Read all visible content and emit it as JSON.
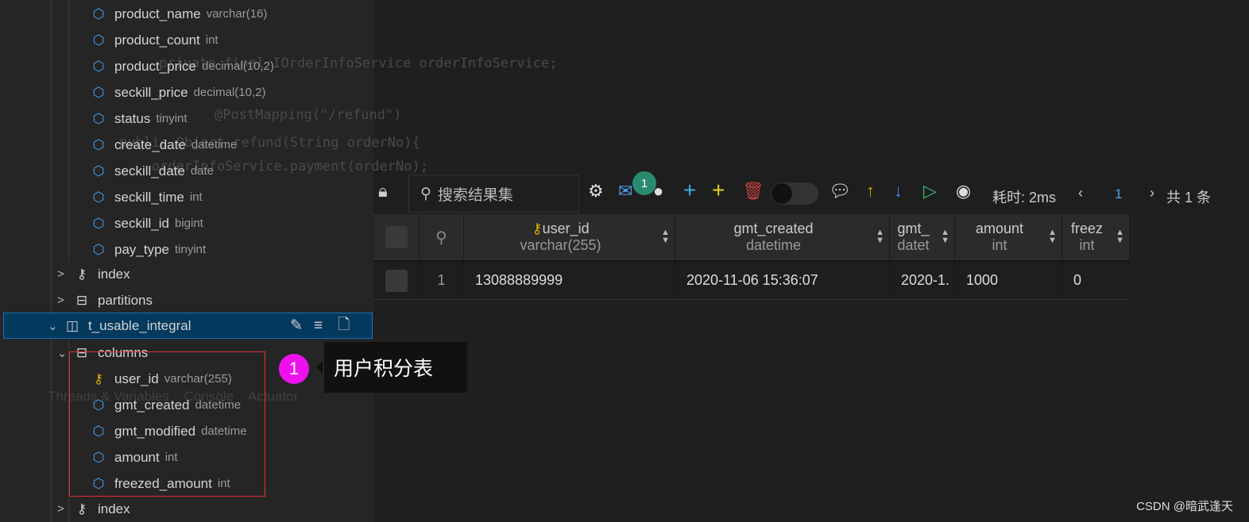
{
  "background_code": [
    "private final IOrderInfoService orderInfoService;",
    "@PostMapping(\"/refund\")",
    "public Object refund(String orderNo){",
    "    orderInfoService.payment(orderNo);",
    "Threads & Variables    Console    Actuator"
  ],
  "tree": {
    "columns_prev": [
      {
        "name": "product_name",
        "type": "varchar(16)"
      },
      {
        "name": "product_count",
        "type": "int"
      },
      {
        "name": "product_price",
        "type": "decimal(10,2)"
      },
      {
        "name": "seckill_price",
        "type": "decimal(10,2)"
      },
      {
        "name": "status",
        "type": "tinyint"
      },
      {
        "name": "create_date",
        "type": "datetime"
      },
      {
        "name": "seckill_date",
        "type": "date"
      },
      {
        "name": "seckill_time",
        "type": "int"
      },
      {
        "name": "seckill_id",
        "type": "bigint"
      },
      {
        "name": "pay_type",
        "type": "tinyint"
      }
    ],
    "index_label": "index",
    "partitions_label": "partitions",
    "table_name": "t_usable_integral",
    "columns_label": "columns",
    "columns": [
      {
        "name": "user_id",
        "type": "varchar(255)",
        "icon": "key-icon"
      },
      {
        "name": "gmt_created",
        "type": "datetime",
        "icon": "cube-icon"
      },
      {
        "name": "gmt_modified",
        "type": "datetime",
        "icon": "cube-icon"
      },
      {
        "name": "amount",
        "type": "int",
        "icon": "cube-icon"
      },
      {
        "name": "freezed_amount",
        "type": "int",
        "icon": "cube-icon"
      }
    ],
    "index2_label": "index"
  },
  "annotation": {
    "number": "1",
    "text": "用户积分表"
  },
  "toolbar": {
    "search_placeholder": "搜索结果集",
    "notification_count": "1",
    "time_label": "耗时: 2ms",
    "page": "1",
    "total": "共 1 条"
  },
  "grid": {
    "headers": [
      {
        "name": "user_id",
        "type": "varchar(255)"
      },
      {
        "name": "gmt_created",
        "type": "datetime"
      },
      {
        "name": "gmt_",
        "type": "datet"
      },
      {
        "name": "amount",
        "type": "int"
      },
      {
        "name": "freez",
        "type": "int"
      }
    ],
    "rows": [
      {
        "index": "1",
        "cells": [
          "13088889999",
          "2020-11-06 15:36:07",
          "2020-1.",
          "1000",
          "0"
        ]
      }
    ]
  },
  "watermark": "CSDN @暗武逢天",
  "colors": {
    "accent": "#4aa3f0",
    "key": "#d4b000",
    "annotation": "#ee11ee"
  }
}
